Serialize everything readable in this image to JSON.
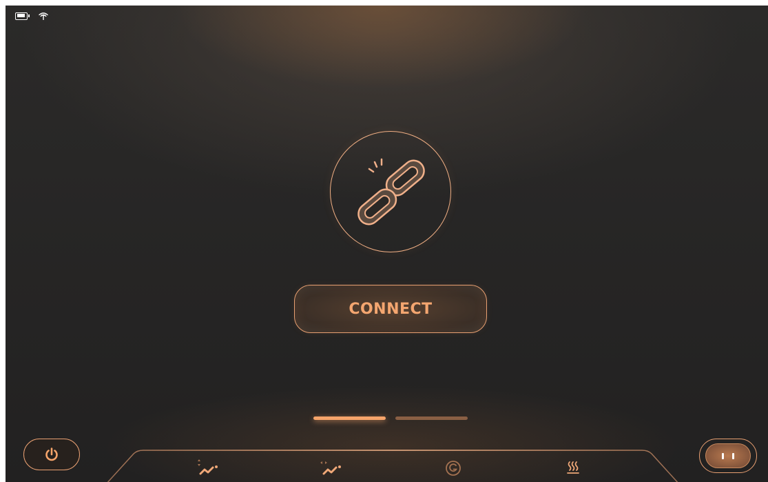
{
  "status_bar": {
    "battery_icon": "battery-icon",
    "wifi_icon": "wifi-icon"
  },
  "connection": {
    "icon": "broken-link-icon",
    "button_label": "CONNECT"
  },
  "page_indicator": {
    "pages": 2,
    "active_index": 0
  },
  "bottom_bar": {
    "power_icon": "power-icon",
    "robot_icon": "robot-face-icon",
    "modes": [
      {
        "icon": "vertical-wave-mode-icon"
      },
      {
        "icon": "horizontal-wave-mode-icon"
      },
      {
        "icon": "g-mode-icon"
      },
      {
        "icon": "heat-mode-icon"
      }
    ]
  },
  "colors": {
    "accent": "#f4a670",
    "accent_outline": "#e9a072",
    "background": "#2b2a29",
    "inactive_indicator": "#8a5f44"
  }
}
